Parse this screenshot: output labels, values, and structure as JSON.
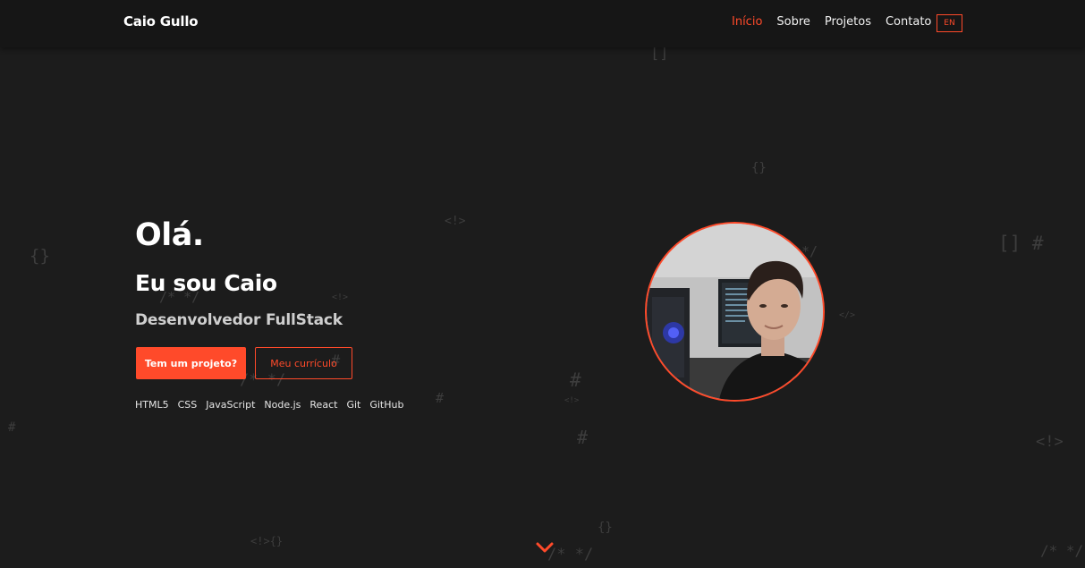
{
  "header": {
    "brand": "Caio Gullo",
    "nav": [
      {
        "label": "Início"
      },
      {
        "label": "Sobre"
      },
      {
        "label": "Projetos"
      },
      {
        "label": "Contato"
      }
    ],
    "lang": "EN"
  },
  "hero": {
    "greeting": "Olá.",
    "intro": "Eu sou Caio",
    "role": "Desenvolvedor FullStack",
    "primary_cta": "Tem um projeto?",
    "secondary_cta": "Meu currículo",
    "skills": [
      "HTML5",
      "CSS",
      "JavaScript",
      "Node.js",
      "React",
      "Git",
      "GitHub"
    ]
  },
  "background_symbols": {
    "brackets": "[]",
    "braces": "{}",
    "hash": "#",
    "brackets_hash": "[] #",
    "html_comment": "<!>",
    "small_tag": "<!>",
    "tag_close": "</>",
    "comment": "/* */",
    "half_comment": "*/",
    "tag_braces": "<!>{}"
  },
  "colors": {
    "accent": "#ff4a2a",
    "background": "#1c1c1c",
    "header_bg": "#161616"
  },
  "icons": {
    "scroll": "chevron-down-icon"
  }
}
